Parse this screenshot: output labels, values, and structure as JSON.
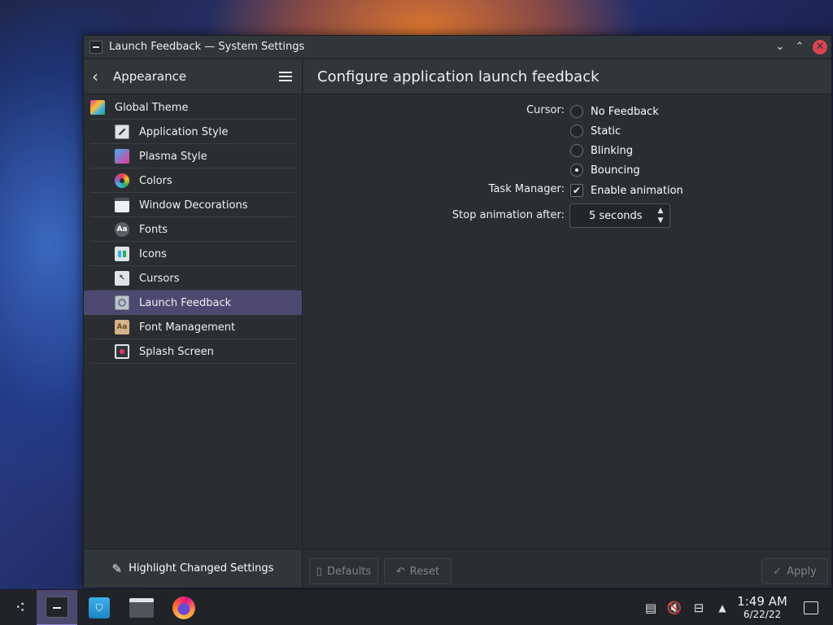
{
  "window": {
    "title": "Launch Feedback — System Settings",
    "minimize_glyph": "⌄",
    "maximize_glyph": "⌃",
    "close_glyph": "✕"
  },
  "sidebar": {
    "back_glyph": "‹",
    "title": "Appearance",
    "items": [
      {
        "label": "Global Theme",
        "icon": "global-theme-icon",
        "selected": false,
        "level": "top"
      },
      {
        "label": "Application Style",
        "icon": "application-style-icon",
        "selected": false,
        "level": "sub"
      },
      {
        "label": "Plasma Style",
        "icon": "plasma-style-icon",
        "selected": false,
        "level": "sub"
      },
      {
        "label": "Colors",
        "icon": "colors-icon",
        "selected": false,
        "level": "sub"
      },
      {
        "label": "Window Decorations",
        "icon": "window-decorations-icon",
        "selected": false,
        "level": "sub"
      },
      {
        "label": "Fonts",
        "icon": "fonts-icon",
        "selected": false,
        "level": "sub"
      },
      {
        "label": "Icons",
        "icon": "icons-icon",
        "selected": false,
        "level": "sub"
      },
      {
        "label": "Cursors",
        "icon": "cursors-icon",
        "selected": false,
        "level": "sub"
      },
      {
        "label": "Launch Feedback",
        "icon": "launch-feedback-icon",
        "selected": true,
        "level": "sub"
      },
      {
        "label": "Font Management",
        "icon": "font-management-icon",
        "selected": false,
        "level": "sub"
      },
      {
        "label": "Splash Screen",
        "icon": "splash-screen-icon",
        "selected": false,
        "level": "sub"
      }
    ],
    "fonts_icon_text": "Aa",
    "font_mgmt_icon_text": "Aa",
    "highlight_button": "Highlight Changed Settings",
    "highlight_icon": "pen-icon"
  },
  "main": {
    "title": "Configure application launch feedback",
    "cursor_label": "Cursor:",
    "cursor_options": [
      {
        "label": "No Feedback",
        "checked": false
      },
      {
        "label": "Static",
        "checked": false
      },
      {
        "label": "Blinking",
        "checked": false
      },
      {
        "label": "Bouncing",
        "checked": true
      }
    ],
    "task_manager_label": "Task Manager:",
    "enable_animation_label": "Enable animation",
    "enable_animation_checked": true,
    "stop_animation_label": "Stop animation after:",
    "stop_animation_value": "5 seconds",
    "footer": {
      "defaults": "Defaults",
      "reset": "Reset",
      "apply": "Apply"
    }
  },
  "taskbar": {
    "items": [
      "application-launcher",
      "system-settings",
      "discover",
      "dolphin",
      "firefox"
    ],
    "active": "system-settings",
    "tray_icons": [
      "clipboard-icon",
      "volume-muted-icon",
      "network-icon",
      "tray-expand-icon"
    ],
    "time": "1:49 AM",
    "date": "6/22/22"
  },
  "colors": {
    "accent": "#4d4870",
    "window_bg": "#2a2e32",
    "header_bg": "#31363b",
    "close_button": "#da4453"
  }
}
